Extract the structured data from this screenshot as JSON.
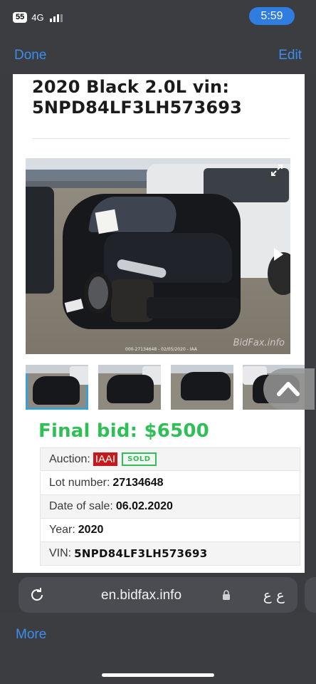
{
  "status_bar": {
    "battery": "55",
    "network": "4G",
    "time": "5:59"
  },
  "nav": {
    "done_label": "Done",
    "edit_label": "Edit"
  },
  "listing": {
    "title_line1": "2020 Black 2.0L vin:",
    "title_line2": "5NPD84LF3LH573693",
    "photo_caption": "000-27134648 - 02/05/2020 - IAA",
    "photo_watermark": "BidFax.info",
    "final_bid_label": "Final bid:",
    "final_bid_value": "$6500",
    "auction_label": "Auction:",
    "auction_value": "IAAI",
    "auction_status": "SOLD",
    "lot_label": "Lot number:",
    "lot_value": "27134648",
    "date_label": "Date of sale:",
    "date_value": "06.02.2020",
    "year_label": "Year:",
    "year_value": "2020",
    "vin_label": "VIN:",
    "vin_value": "5NPD84LF3LH573693"
  },
  "browser": {
    "url": "en.bidfax.info",
    "reader_label": "ع ع"
  },
  "toolbar": {
    "more_label": "More"
  },
  "icons": {
    "expand": "expand-icon",
    "next": "play-next-icon",
    "scroll_up": "chevron-up-icon",
    "reload": "reload-icon",
    "lock": "lock-icon"
  },
  "colors": {
    "accent_blue": "#3b8ef0",
    "bid_green": "#2fbf57",
    "iaai_red": "#c8181b"
  }
}
